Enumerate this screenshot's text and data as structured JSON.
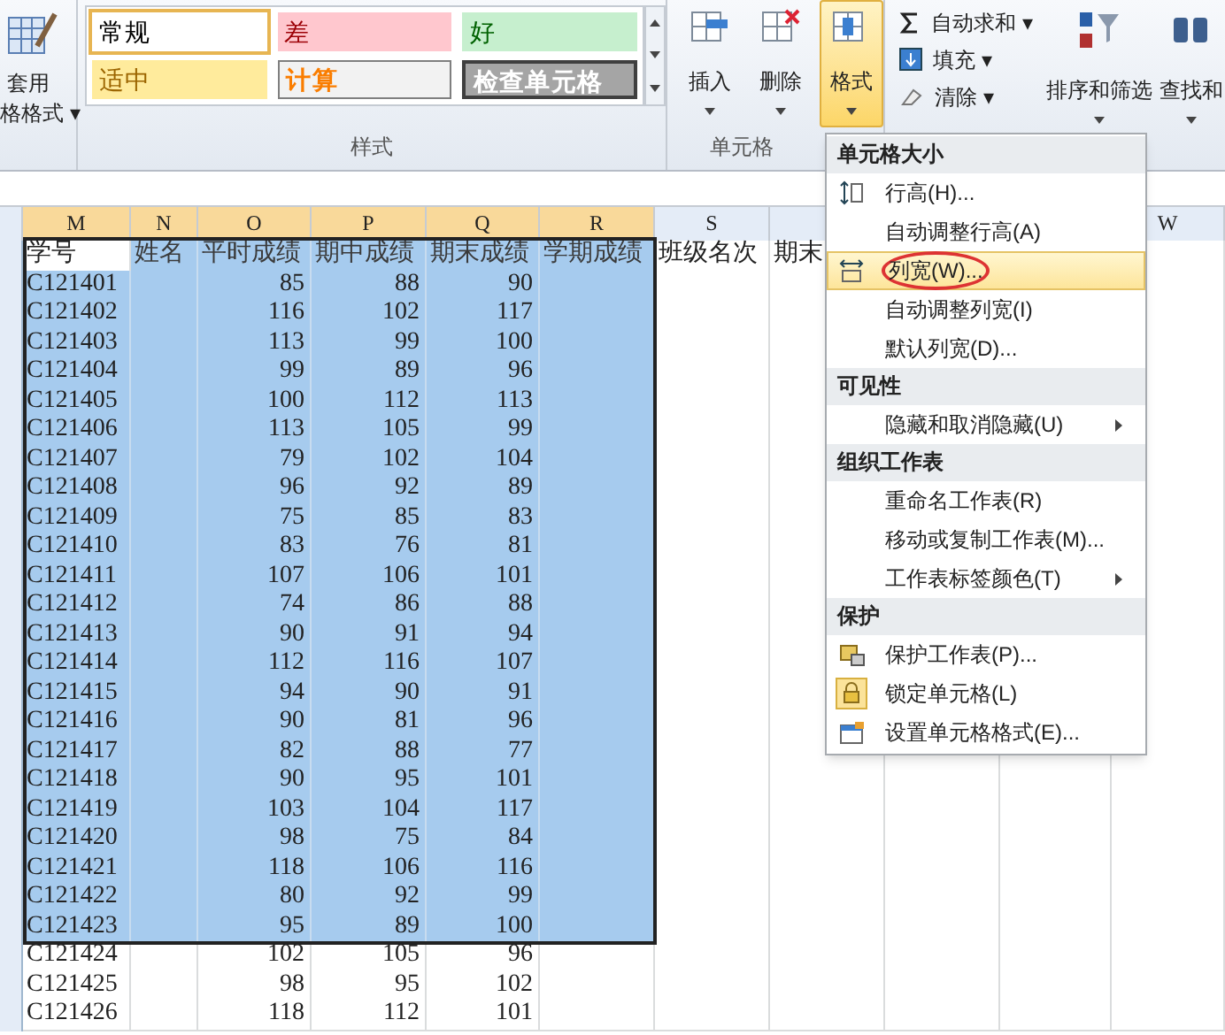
{
  "ribbon": {
    "table_format": {
      "label_1": "套用",
      "label_2": "格格式 ▾"
    },
    "styles": {
      "group_label": "样式",
      "items": [
        {
          "label": "常规",
          "kind": "normal",
          "selected": true
        },
        {
          "label": "差",
          "kind": "bad",
          "selected": false
        },
        {
          "label": "好",
          "kind": "good",
          "selected": false
        },
        {
          "label": "适中",
          "kind": "neutral",
          "selected": false
        },
        {
          "label": "计算",
          "kind": "calc",
          "selected": false
        },
        {
          "label": "检查单元格",
          "kind": "check",
          "selected": false
        }
      ]
    },
    "cells": {
      "group_label": "单元格",
      "buttons": [
        {
          "label": "插入",
          "kind": "insert",
          "active": false
        },
        {
          "label": "删除",
          "kind": "delete",
          "active": false
        },
        {
          "label": "格式",
          "kind": "format",
          "active": true
        }
      ]
    },
    "editing": {
      "small": [
        {
          "label": "自动求和 ▾",
          "kind": "sum"
        },
        {
          "label": "填充 ▾",
          "kind": "fill"
        },
        {
          "label": "清除 ▾",
          "kind": "clear"
        }
      ],
      "large": [
        {
          "label": "排序和筛选",
          "kind": "sort"
        },
        {
          "label": "查找和",
          "kind": "find"
        }
      ]
    }
  },
  "sheet": {
    "columns": [
      {
        "label": "M",
        "selected": true
      },
      {
        "label": "N",
        "selected": true
      },
      {
        "label": "O",
        "selected": true
      },
      {
        "label": "P",
        "selected": true
      },
      {
        "label": "Q",
        "selected": true
      },
      {
        "label": "R",
        "selected": true
      },
      {
        "label": "S",
        "selected": false
      },
      {
        "label": "W",
        "selected": false
      }
    ],
    "header_row": {
      "selected": true,
      "cells": [
        {
          "text": "学号",
          "active": true
        },
        {
          "text": "姓名",
          "active": false
        },
        {
          "text": "平时成绩",
          "active": false
        },
        {
          "text": "期中成绩",
          "active": false
        },
        {
          "text": "期末成绩",
          "active": false
        },
        {
          "text": "学期成绩",
          "active": false
        },
        {
          "text": "班级名次",
          "active": false
        },
        {
          "text": "期末",
          "active": false
        }
      ]
    },
    "rows": [
      {
        "id": "C121401",
        "scores": [
          "85",
          "88",
          "90"
        ],
        "selected": true
      },
      {
        "id": "C121402",
        "scores": [
          "116",
          "102",
          "117"
        ],
        "selected": true
      },
      {
        "id": "C121403",
        "scores": [
          "113",
          "99",
          "100"
        ],
        "selected": true
      },
      {
        "id": "C121404",
        "scores": [
          "99",
          "89",
          "96"
        ],
        "selected": true
      },
      {
        "id": "C121405",
        "scores": [
          "100",
          "112",
          "113"
        ],
        "selected": true
      },
      {
        "id": "C121406",
        "scores": [
          "113",
          "105",
          "99"
        ],
        "selected": true
      },
      {
        "id": "C121407",
        "scores": [
          "79",
          "102",
          "104"
        ],
        "selected": true
      },
      {
        "id": "C121408",
        "scores": [
          "96",
          "92",
          "89"
        ],
        "selected": true
      },
      {
        "id": "C121409",
        "scores": [
          "75",
          "85",
          "83"
        ],
        "selected": true
      },
      {
        "id": "C121410",
        "scores": [
          "83",
          "76",
          "81"
        ],
        "selected": true
      },
      {
        "id": "C121411",
        "scores": [
          "107",
          "106",
          "101"
        ],
        "selected": true
      },
      {
        "id": "C121412",
        "scores": [
          "74",
          "86",
          "88"
        ],
        "selected": true
      },
      {
        "id": "C121413",
        "scores": [
          "90",
          "91",
          "94"
        ],
        "selected": true
      },
      {
        "id": "C121414",
        "scores": [
          "112",
          "116",
          "107"
        ],
        "selected": true
      },
      {
        "id": "C121415",
        "scores": [
          "94",
          "90",
          "91"
        ],
        "selected": true
      },
      {
        "id": "C121416",
        "scores": [
          "90",
          "81",
          "96"
        ],
        "selected": true
      },
      {
        "id": "C121417",
        "scores": [
          "82",
          "88",
          "77"
        ],
        "selected": true
      },
      {
        "id": "C121418",
        "scores": [
          "90",
          "95",
          "101"
        ],
        "selected": true
      },
      {
        "id": "C121419",
        "scores": [
          "103",
          "104",
          "117"
        ],
        "selected": true
      },
      {
        "id": "C121420",
        "scores": [
          "98",
          "75",
          "84"
        ],
        "selected": true
      },
      {
        "id": "C121421",
        "scores": [
          "118",
          "106",
          "116"
        ],
        "selected": true
      },
      {
        "id": "C121422",
        "scores": [
          "80",
          "92",
          "99"
        ],
        "selected": true
      },
      {
        "id": "C121423",
        "scores": [
          "95",
          "89",
          "100"
        ],
        "selected": true
      },
      {
        "id": "C121424",
        "scores": [
          "102",
          "105",
          "96"
        ],
        "selected": false
      },
      {
        "id": "C121425",
        "scores": [
          "98",
          "95",
          "102"
        ],
        "selected": false
      },
      {
        "id": "C121426",
        "scores": [
          "118",
          "112",
          "101"
        ],
        "selected": false
      }
    ]
  },
  "format_menu": {
    "items": [
      {
        "kind": "section",
        "label": "单元格大小"
      },
      {
        "kind": "item",
        "label": "行高(H)...",
        "selected": false,
        "circled": false
      },
      {
        "kind": "item",
        "label": "自动调整行高(A)",
        "selected": false,
        "circled": false
      },
      {
        "kind": "item",
        "label": "列宽(W)...",
        "selected": true,
        "circled": true
      },
      {
        "kind": "item",
        "label": "自动调整列宽(I)",
        "selected": false,
        "circled": false
      },
      {
        "kind": "item",
        "label": "默认列宽(D)...",
        "selected": false,
        "circled": false
      },
      {
        "kind": "section",
        "label": "可见性"
      },
      {
        "kind": "item",
        "label": "隐藏和取消隐藏(U)",
        "submenu": true,
        "selected": false,
        "circled": false
      },
      {
        "kind": "section",
        "label": "组织工作表"
      },
      {
        "kind": "item",
        "label": "重命名工作表(R)",
        "selected": false,
        "circled": false
      },
      {
        "kind": "item",
        "label": "移动或复制工作表(M)...",
        "selected": false,
        "circled": false
      },
      {
        "kind": "item",
        "label": "工作表标签颜色(T)",
        "submenu": true,
        "selected": false,
        "circled": false
      },
      {
        "kind": "section",
        "label": "保护"
      },
      {
        "kind": "item",
        "label": "保护工作表(P)...",
        "selected": false,
        "circled": false
      },
      {
        "kind": "item",
        "label": "锁定单元格(L)",
        "selected": false,
        "circled": false
      },
      {
        "kind": "item",
        "label": "设置单元格格式(E)...",
        "selected": false,
        "circled": false
      }
    ]
  }
}
